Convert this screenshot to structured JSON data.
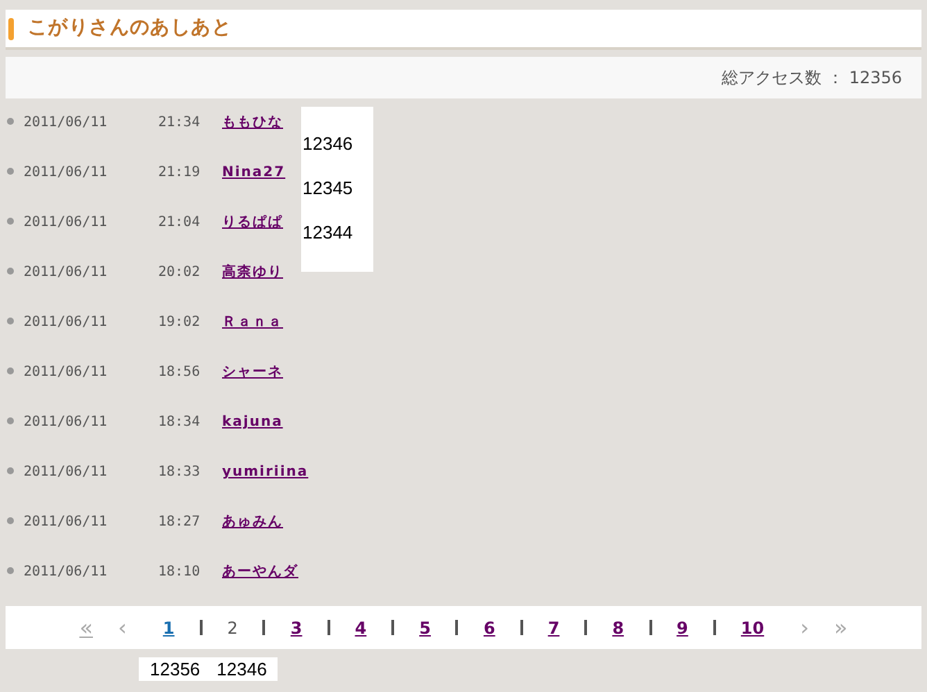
{
  "title": "こがりさんのあしあと",
  "total_access": "総アクセス数 ： 12356",
  "visits": [
    {
      "date": "2011/06/11",
      "time": "21:34",
      "name": "ももひな"
    },
    {
      "date": "2011/06/11",
      "time": "21:19",
      "name": "Nina27"
    },
    {
      "date": "2011/06/11",
      "time": "21:04",
      "name": "りるぱぱ"
    },
    {
      "date": "2011/06/11",
      "time": "20:02",
      "name": "高柰ゆり"
    },
    {
      "date": "2011/06/11",
      "time": "19:02",
      "name": "Ｒａｎａ"
    },
    {
      "date": "2011/06/11",
      "time": "18:56",
      "name": "シャーネ"
    },
    {
      "date": "2011/06/11",
      "time": "18:34",
      "name": "kajuna"
    },
    {
      "date": "2011/06/11",
      "time": "18:33",
      "name": "yumiriina"
    },
    {
      "date": "2011/06/11",
      "time": "18:27",
      "name": "あゅみん"
    },
    {
      "date": "2011/06/11",
      "time": "18:10",
      "name": "あーやんダ"
    }
  ],
  "overlay_numbers": [
    "12346",
    "12345",
    "12344"
  ],
  "pagination": {
    "first": "«",
    "prev": "‹",
    "next": "›",
    "last": "»",
    "pages": [
      {
        "label": "1",
        "selected": false,
        "visited": false
      },
      {
        "label": "2",
        "selected": true
      },
      {
        "label": "3",
        "selected": false,
        "visited": true
      },
      {
        "label": "4",
        "selected": false,
        "visited": true
      },
      {
        "label": "5",
        "selected": false,
        "visited": true
      },
      {
        "label": "6",
        "selected": false,
        "visited": true
      },
      {
        "label": "7",
        "selected": false,
        "visited": true
      },
      {
        "label": "8",
        "selected": false,
        "visited": true
      },
      {
        "label": "9",
        "selected": false,
        "visited": true
      },
      {
        "label": "10",
        "selected": false,
        "visited": true
      }
    ]
  },
  "footer_numbers": [
    "12356",
    "12346"
  ]
}
